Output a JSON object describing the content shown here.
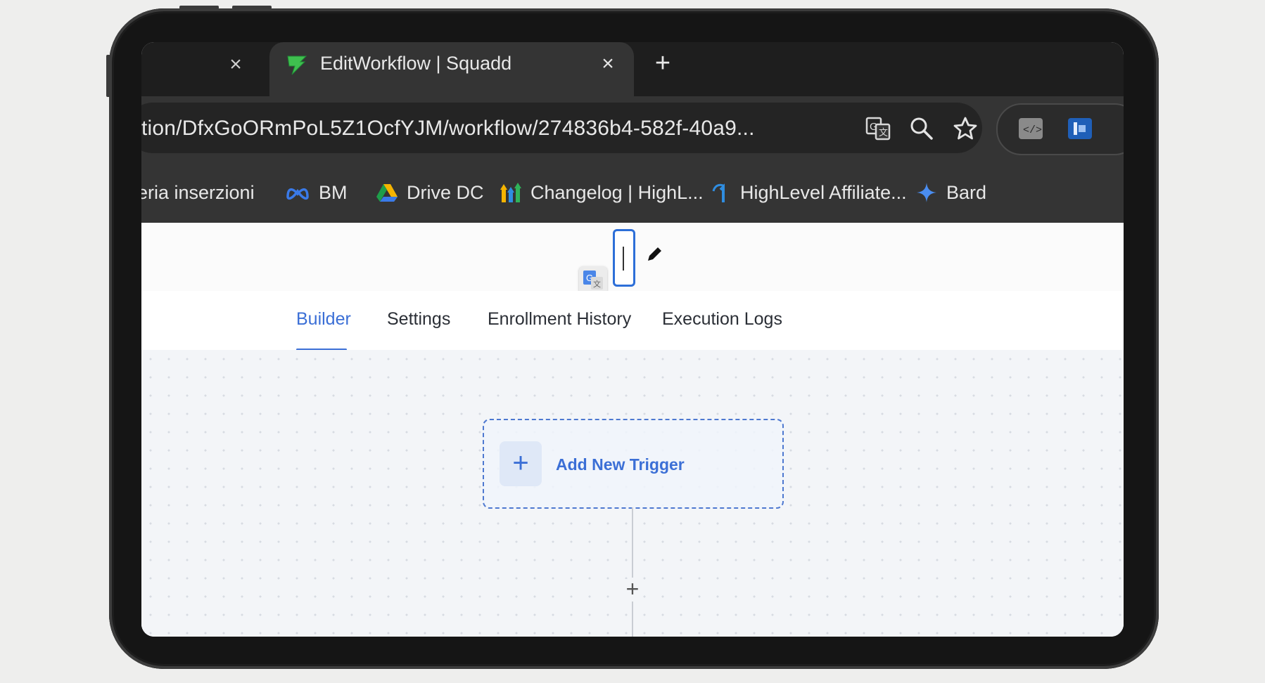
{
  "browser": {
    "active_tab": {
      "title": "EditWorkflow | Squadd",
      "icon": "squadd-logo-icon"
    },
    "url": "tion/DfxGoORmPoL5Z1OcfYJM/workflow/274836b4-582f-40a9...",
    "bookmarks": [
      {
        "label": "eria inserzioni",
        "icon": ""
      },
      {
        "label": "BM",
        "icon": "meta-icon"
      },
      {
        "label": "Drive DC",
        "icon": "google-drive-icon"
      },
      {
        "label": "Changelog | HighL...",
        "icon": "highlevel-icon"
      },
      {
        "label": "HighLevel Affiliate...",
        "icon": "highlevel-affiliate-icon"
      },
      {
        "label": "Bard",
        "icon": "bard-sparkle-icon"
      }
    ]
  },
  "workflow": {
    "tabs": [
      {
        "label": "Builder",
        "active": true
      },
      {
        "label": "Settings",
        "active": false
      },
      {
        "label": "Enrollment History",
        "active": false
      },
      {
        "label": "Execution Logs",
        "active": false
      }
    ],
    "trigger_label": "Add New Trigger"
  },
  "colors": {
    "accent": "#3b6fd6",
    "chrome_dark": "#343434",
    "canvas_bg": "#f3f5f8"
  }
}
